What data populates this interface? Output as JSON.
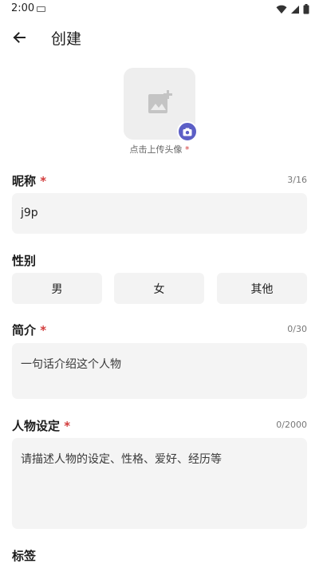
{
  "status_bar": {
    "time": "2:00",
    "icons": [
      "keyboard-icon",
      "wifi-icon",
      "signal-icon",
      "battery-icon"
    ]
  },
  "app_bar": {
    "back_icon": "arrow-left-icon",
    "title": "创建"
  },
  "avatar": {
    "placeholder_icon": "add-photo-icon",
    "camera_icon": "camera-icon",
    "hint": "点击上传头像",
    "required_mark": "*"
  },
  "nickname": {
    "label": "昵称",
    "required_mark": "*",
    "counter": "3/16",
    "value": "j9p"
  },
  "gender": {
    "label": "性别",
    "options": [
      "男",
      "女",
      "其他"
    ]
  },
  "intro": {
    "label": "简介",
    "required_mark": "*",
    "counter": "0/30",
    "placeholder": "一句话介绍这个人物"
  },
  "character_setting": {
    "label": "人物设定",
    "required_mark": "*",
    "counter": "0/2000",
    "placeholder": "请描述人物的设定、性格、爱好、经历等"
  },
  "tags": {
    "label": "标签"
  },
  "colors": {
    "accent": "#5c5fc6",
    "required": "#d23b3b",
    "field_bg": "#f4f4f4"
  }
}
